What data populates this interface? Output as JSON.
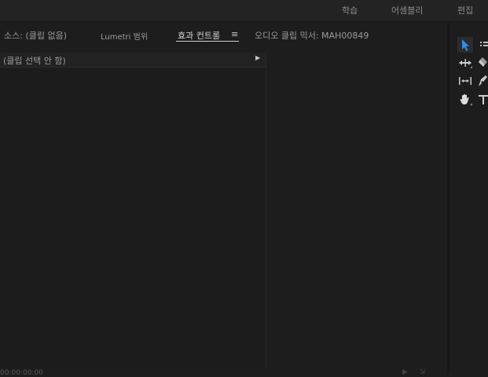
{
  "workspace_tabs": [
    "학습",
    "어셈블리",
    "편집"
  ],
  "panel_tabs": {
    "source": "소스: (클립 없음)",
    "lumetri_scopes": "Lumetri 범위",
    "effect_controls": "효과 컨트롤",
    "audio_clip_mixer": "오디오 클립 믹서: MAH00849"
  },
  "effect_controls": {
    "clip_header": "(클립 선택 안 함)",
    "timecode": "00:00:00:00"
  },
  "tools": [
    "selection-tool",
    "track-select-tool",
    "ripple-edit-tool",
    "razor-tool",
    "slip-tool",
    "pen-tool",
    "hand-tool",
    "type-tool"
  ],
  "colors": {
    "accent": "#2d8ceb",
    "background": "#1d1d1d",
    "text": "#9a9a9a"
  }
}
